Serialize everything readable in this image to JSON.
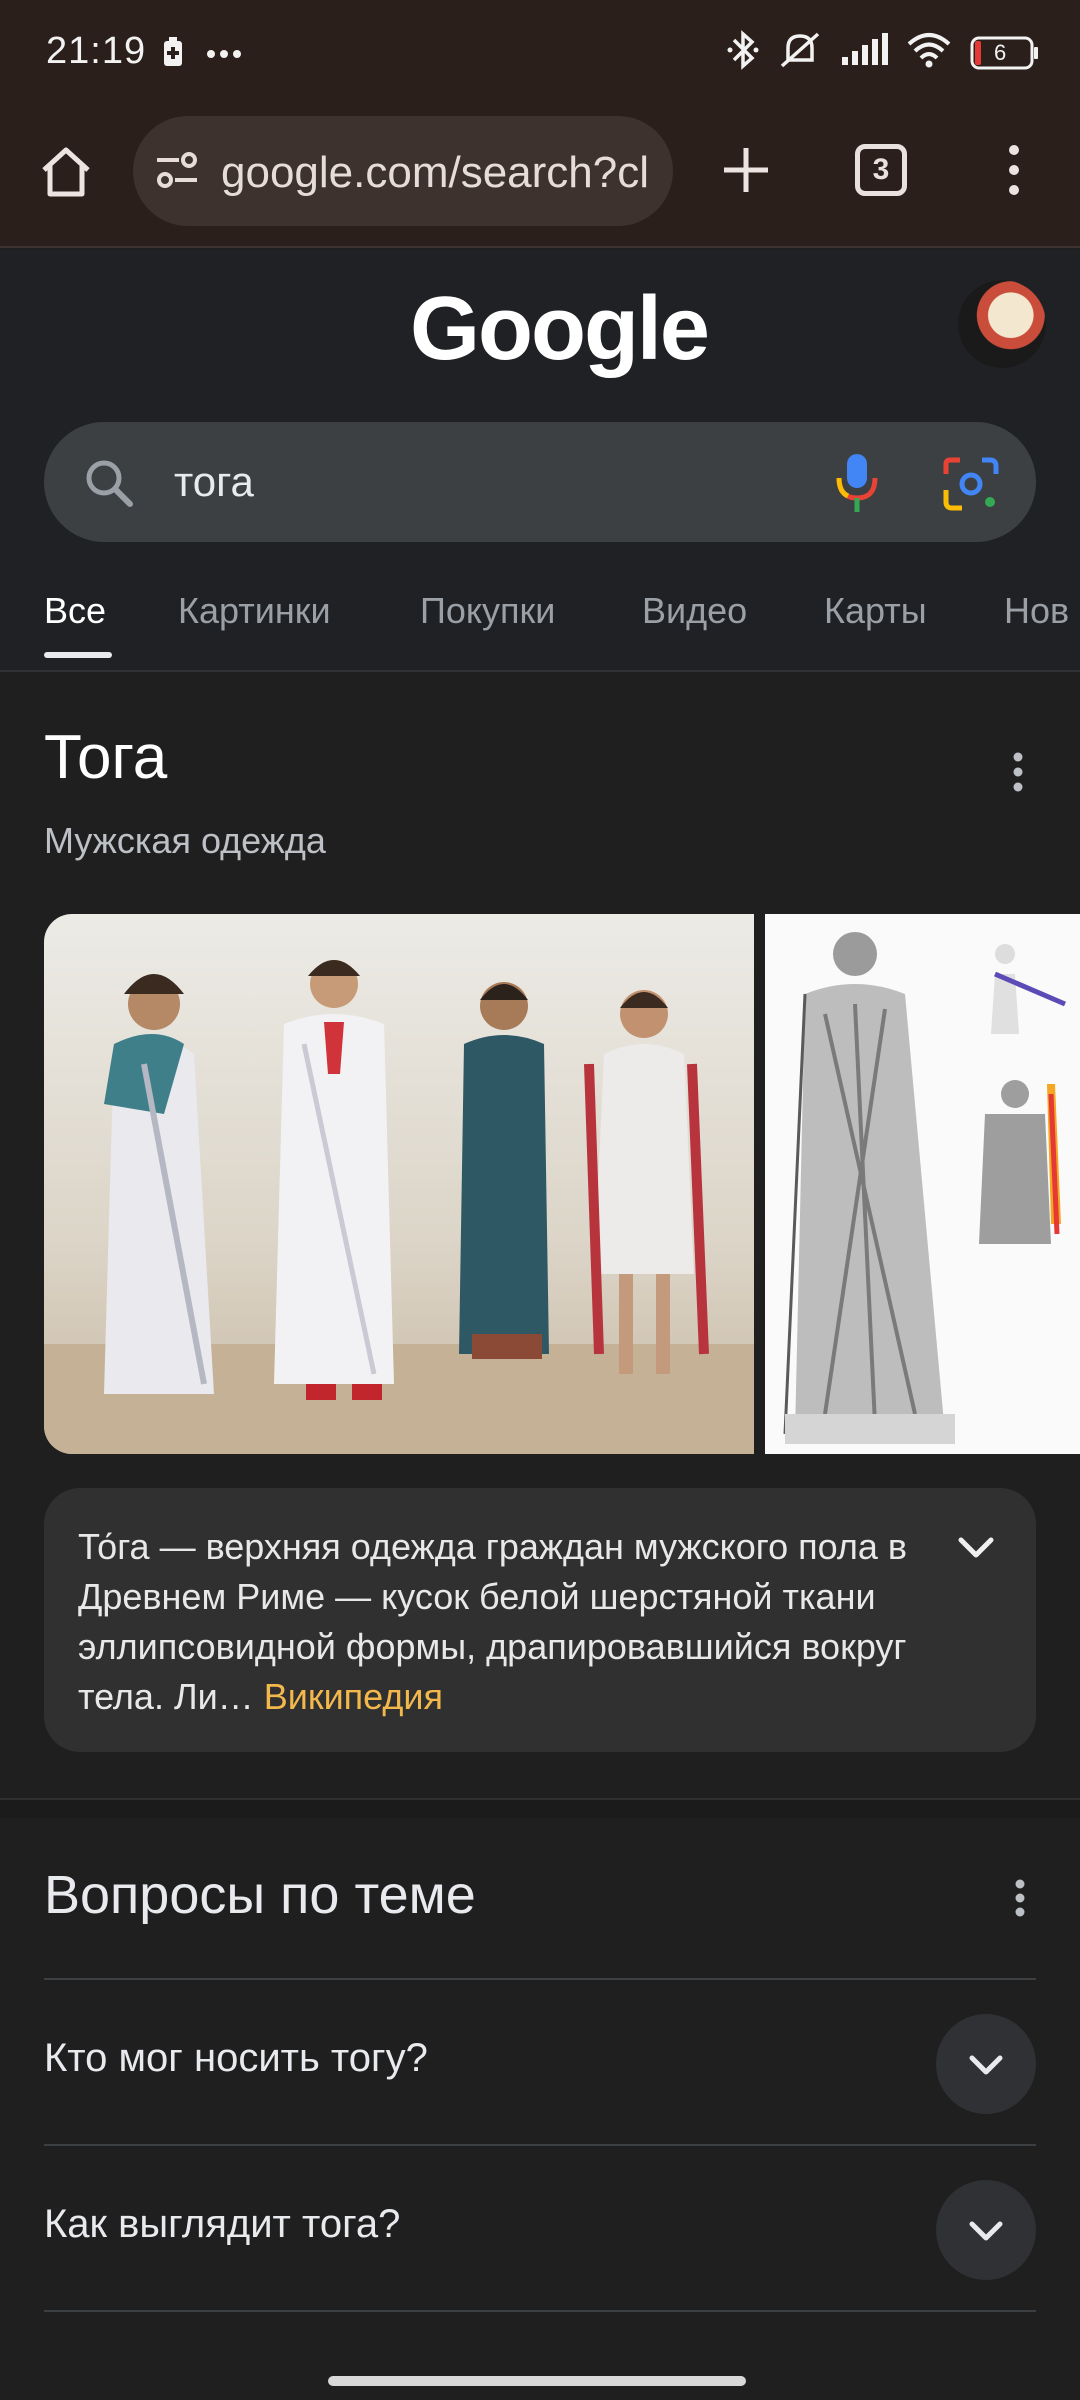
{
  "status_bar": {
    "time": "21:19",
    "battery": "6"
  },
  "browser": {
    "url": "google.com/search?cl",
    "tab_count": "3"
  },
  "google": {
    "logo": "Google",
    "search_query": "тога",
    "tabs": [
      "Все",
      "Картинки",
      "Покупки",
      "Видео",
      "Карты",
      "Нов"
    ]
  },
  "knowledge_panel": {
    "title": "Тога",
    "subtitle": "Мужская одежда",
    "description": "То́га — верхняя одежда граждан мужского пола в Древнем Риме — кусок белой шерстяной ткани эллипсовидной формы, драпировавшийся вокруг тела. Ли…",
    "source": "Википедия"
  },
  "paa": {
    "title": "Вопросы по теме",
    "questions": [
      "Кто мог носить тогу?",
      "Как выглядит тога?"
    ]
  },
  "colors": {
    "accent_link": "#f2b84b",
    "browser_bar": "#2b1f1b",
    "page_bg": "#1f1f1f"
  }
}
